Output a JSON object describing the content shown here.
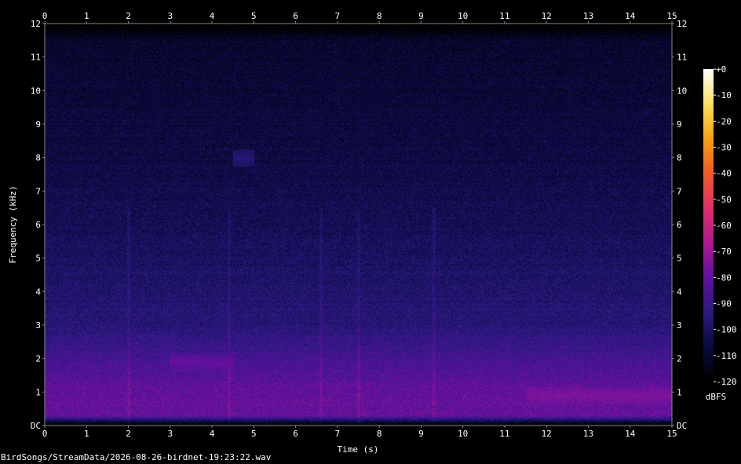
{
  "chart_data": {
    "type": "heatmap",
    "title": "",
    "xlabel": "Time (s)",
    "ylabel": "Frequency (kHz)",
    "xlim": [
      0,
      15
    ],
    "ylim": [
      0,
      12
    ],
    "x_ticks": [
      "0",
      "1",
      "2",
      "3",
      "4",
      "5",
      "6",
      "7",
      "8",
      "9",
      "10",
      "11",
      "12",
      "13",
      "14",
      "15"
    ],
    "y_ticks": [
      "DC",
      "1",
      "2",
      "3",
      "4",
      "5",
      "6",
      "7",
      "8",
      "9",
      "10",
      "11",
      "12"
    ],
    "colorbar": {
      "label": "dBFS",
      "range": [
        -120,
        0
      ],
      "ticks": [
        "+0",
        "-10",
        "-20",
        "-30",
        "-40",
        "-50",
        "-60",
        "-70",
        "-80",
        "-90",
        "-100",
        "-110",
        "-120"
      ]
    },
    "level_profile_dbfs": [
      {
        "freq_khz": 0.0,
        "level": -125
      },
      {
        "freq_khz": 0.3,
        "level": -80
      },
      {
        "freq_khz": 1.0,
        "level": -80
      },
      {
        "freq_khz": 2.0,
        "level": -86
      },
      {
        "freq_khz": 3.0,
        "level": -95
      },
      {
        "freq_khz": 5.0,
        "level": -100
      },
      {
        "freq_khz": 8.0,
        "level": -106
      },
      {
        "freq_khz": 11.5,
        "level": -110
      },
      {
        "freq_khz": 12.0,
        "level": -125
      }
    ],
    "vertical_events_s": [
      2.0,
      4.4,
      6.6,
      7.5,
      9.3
    ],
    "notable_features": [
      {
        "time_start_s": 4.5,
        "time_end_s": 5.0,
        "freq_khz": 8.0,
        "level": -95
      },
      {
        "time_start_s": 11.5,
        "time_end_s": 15.0,
        "freq_khz": 0.9,
        "level": -75
      },
      {
        "time_start_s": 3.0,
        "time_end_s": 4.5,
        "freq_khz": 1.9,
        "level": -80
      }
    ]
  },
  "colors": {
    "background": "#000000",
    "colormap": [
      "#000000",
      "#0a0a40",
      "#2a1a80",
      "#6010a0",
      "#b01890",
      "#e0306a",
      "#f05a28",
      "#f8a010",
      "#fce060",
      "#ffffff"
    ]
  },
  "file_label": "BirdSongs/StreamData/2026-08-26-birdnet-19:23:22.wav"
}
